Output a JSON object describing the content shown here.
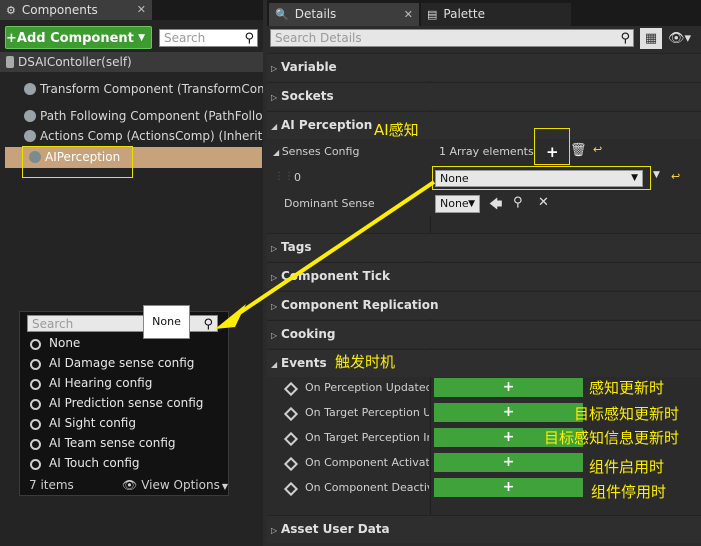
{
  "components_panel": {
    "tab_title": "Components",
    "add_button_label": "+Add Component",
    "search_placeholder": "Search",
    "items": [
      "DSAIContoller(self)",
      "Transform Component (TransformComp",
      "Path Following Component (PathFollow",
      "Actions Comp (ActionsComp) (Inherited)",
      "AIPerception"
    ]
  },
  "sense_picker": {
    "search_placeholder": "Search",
    "tooltip": "None",
    "options": [
      "None",
      "AI Damage sense config",
      "AI Hearing config",
      "AI Prediction sense config",
      "AI Sight config",
      "AI Team sense config",
      "AI Touch config"
    ],
    "items_count": "7 items",
    "view_options_label": "View Options"
  },
  "details_panel": {
    "tabs": [
      "Details",
      "Palette"
    ],
    "search_placeholder": "Search Details",
    "categories": {
      "variable": "Variable",
      "sockets": "Sockets",
      "ai_perception": "AI Perception",
      "tags": "Tags",
      "component_tick": "Component Tick",
      "component_replication": "Component Replication",
      "cooking": "Cooking",
      "events": "Events",
      "asset_user_data": "Asset User Data"
    },
    "senses_config_label": "Senses Config",
    "array_elements": "1 Array elements",
    "index_label": "0",
    "index_value": "None",
    "dominant_sense_label": "Dominant Sense",
    "dominant_sense_value": "None",
    "events": [
      "On Perception Updated",
      "On Target Perception Upd",
      "On Target Perception Info",
      "On Component Activated",
      "On Component Deactivat"
    ],
    "event_button_label": "+"
  },
  "annotations": {
    "ai_perception": "AI感知",
    "events": "触发时机",
    "event_notes": [
      "感知更新时",
      "目标感知更新时",
      "目标感知信息更新时",
      "组件启用时",
      "组件停用时"
    ]
  },
  "colors": {
    "accent_yellow": "#ffee00",
    "add_green": "#3d9c30",
    "selection": "#c8a27a"
  }
}
